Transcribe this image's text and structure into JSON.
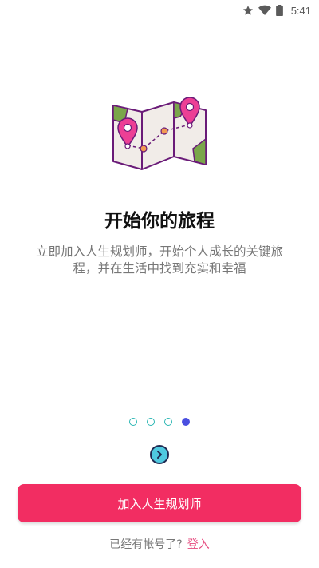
{
  "status_bar": {
    "time": "5:41",
    "icons": [
      "star-icon",
      "wifi-icon",
      "battery-icon"
    ]
  },
  "onboarding": {
    "illustration": "map-with-pins-icon",
    "title": "开始你的旅程",
    "subtitle": "立即加入人生规划师，开始个人成长的关键旅程，并在生活中找到充实和幸福",
    "pager": {
      "total": 4,
      "active_index": 3
    },
    "next_icon": "chevron-right-icon"
  },
  "actions": {
    "join_label": "加入人生规划师",
    "login_prompt": "已经有帐号了?",
    "login_link": "登入"
  },
  "colors": {
    "primary": "#f22d62",
    "link": "#e64a7e",
    "dot_active": "#4a4fe0",
    "dot_inactive": "#2bb6b3"
  }
}
